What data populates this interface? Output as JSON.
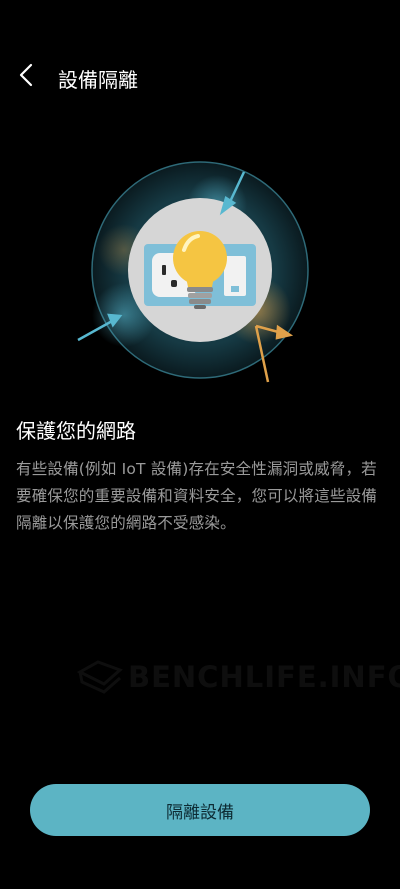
{
  "header": {
    "title": "設備隔離",
    "back_icon": "chevron-left-icon"
  },
  "section": {
    "heading": "保護您的網路",
    "description": "有些設備(例如 IoT 設備)存在安全性漏洞或威脅，若要確保您的重要設備和資料安全，您可以將這些設備隔離以保護您的網路不受感染。"
  },
  "watermark": {
    "text": "BENCHLIFE.INFO"
  },
  "actions": {
    "isolate_label": "隔離設備"
  },
  "colors": {
    "accent": "#5cb4c4",
    "bulb": "#f5c542",
    "warning_arrow": "#e0a14a",
    "info_arrow": "#58b8d0"
  }
}
